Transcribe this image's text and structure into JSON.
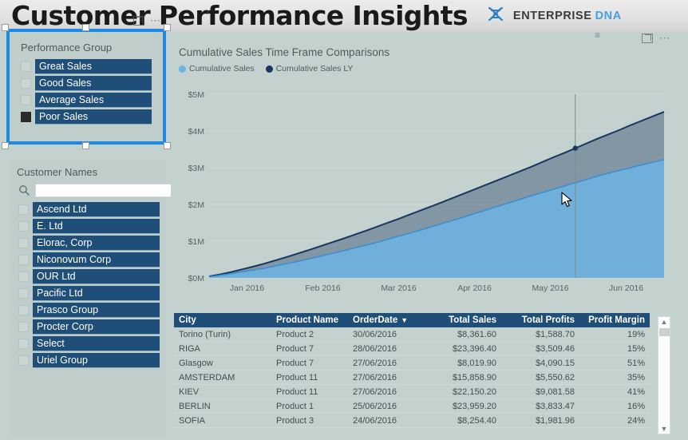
{
  "header": {
    "title": "Customer Performance Insights",
    "brand_primary": "ENTERPRISE",
    "brand_secondary": "DNA",
    "logo_icon": "dna-helix-icon"
  },
  "colors": {
    "page_background": "#c3d1cf",
    "slicer_item": "#1f4e79",
    "selection_border": "#1b8ae5",
    "series_current": "#6cb4e4",
    "series_last_year": "#17375e",
    "brand_accent": "#4a9fe0"
  },
  "performance_slicer": {
    "title": "Performance Group",
    "selected": "Poor Sales",
    "items": [
      {
        "label": "Great Sales",
        "checked": false
      },
      {
        "label": "Good Sales",
        "checked": false
      },
      {
        "label": "Average Sales",
        "checked": false
      },
      {
        "label": "Poor Sales",
        "checked": true
      }
    ]
  },
  "customer_slicer": {
    "title": "Customer Names",
    "search_placeholder": "",
    "search_value": "",
    "search_icon": "search-icon",
    "items": [
      {
        "label": "Ascend Ltd",
        "checked": false
      },
      {
        "label": "E. Ltd",
        "checked": false
      },
      {
        "label": "Elorac, Corp",
        "checked": false
      },
      {
        "label": "Niconovum Corp",
        "checked": false
      },
      {
        "label": "OUR Ltd",
        "checked": false
      },
      {
        "label": "Pacific Ltd",
        "checked": false
      },
      {
        "label": "Prasco Group",
        "checked": false
      },
      {
        "label": "Procter Corp",
        "checked": false
      },
      {
        "label": "Select",
        "checked": false
      },
      {
        "label": "Uriel Group",
        "checked": false
      }
    ]
  },
  "visual_header": {
    "focus_icon": "focus-mode-icon",
    "more_options_icon": "more-options-icon",
    "drag_handle_icon": "drag-handle-icon"
  },
  "chart_data": {
    "type": "area",
    "title": "Cumulative Sales Time Frame Comparisons",
    "xlabel": "",
    "ylabel": "",
    "ylim": [
      0,
      5000000
    ],
    "ytick_labels": [
      "$0M",
      "$1M",
      "$2M",
      "$3M",
      "$4M",
      "$5M"
    ],
    "ytick_values": [
      0,
      1000000,
      2000000,
      3000000,
      4000000,
      5000000
    ],
    "xtick_labels": [
      "Jan 2016",
      "Feb 2016",
      "Mar 2016",
      "Apr 2016",
      "May 2016",
      "Jun 2016"
    ],
    "grid": true,
    "legend_position": "top-left",
    "tooltip_line_x": "Jun 2016",
    "series": [
      {
        "name": "Cumulative Sales",
        "color": "#6cb4e4",
        "values": [
          30000,
          70000,
          120000,
          170000,
          215000,
          265000,
          330000,
          390000,
          450000,
          520000,
          590000,
          660000,
          730000,
          810000,
          880000,
          960000,
          1040000,
          1130000,
          1210000,
          1300000,
          1390000,
          1480000,
          1570000,
          1660000,
          1760000,
          1850000,
          1950000,
          2040000,
          2140000,
          2230000,
          2320000,
          2410000,
          2500000,
          2590000,
          2680000,
          2770000,
          2850000,
          2930000,
          3000000,
          3080000,
          3150000,
          3220000
        ]
      },
      {
        "name": "Cumulative Sales LY",
        "color": "#17375e",
        "values": [
          40000,
          95000,
          160000,
          235000,
          310000,
          390000,
          480000,
          570000,
          665000,
          760000,
          860000,
          960000,
          1060000,
          1165000,
          1270000,
          1380000,
          1490000,
          1600000,
          1715000,
          1830000,
          1945000,
          2060000,
          2180000,
          2300000,
          2420000,
          2540000,
          2660000,
          2780000,
          2900000,
          3020000,
          3150000,
          3280000,
          3400000,
          3530000,
          3660000,
          3790000,
          3910000,
          4030000,
          4160000,
          4280000,
          4400000,
          4520000
        ]
      }
    ]
  },
  "table": {
    "sort_column": "OrderDate",
    "sort_direction": "descending",
    "columns": [
      "City",
      "Product Name",
      "OrderDate",
      "Total Sales",
      "Total Profits",
      "Profit Margin"
    ],
    "rows": [
      [
        "Torino (Turin)",
        "Product 2",
        "30/06/2016",
        "$8,361.60",
        "$1,588.70",
        "19%"
      ],
      [
        "RIGA",
        "Product 7",
        "28/06/2016",
        "$23,396.40",
        "$3,509.46",
        "15%"
      ],
      [
        "Glasgow",
        "Product 7",
        "27/06/2016",
        "$8,019.90",
        "$4,090.15",
        "51%"
      ],
      [
        "AMSTERDAM",
        "Product 11",
        "27/06/2016",
        "$15,858.90",
        "$5,550.62",
        "35%"
      ],
      [
        "KIEV",
        "Product 11",
        "27/06/2016",
        "$22,150.20",
        "$9,081.58",
        "41%"
      ],
      [
        "BERLIN",
        "Product 1",
        "25/06/2016",
        "$23,959.20",
        "$3,833.47",
        "16%"
      ],
      [
        "SOFIA",
        "Product 3",
        "24/06/2016",
        "$8,254.40",
        "$1,981.96",
        "24%"
      ]
    ],
    "scrollbar": {
      "up_icon": "scroll-up-icon",
      "down_icon": "scroll-down-icon"
    }
  }
}
